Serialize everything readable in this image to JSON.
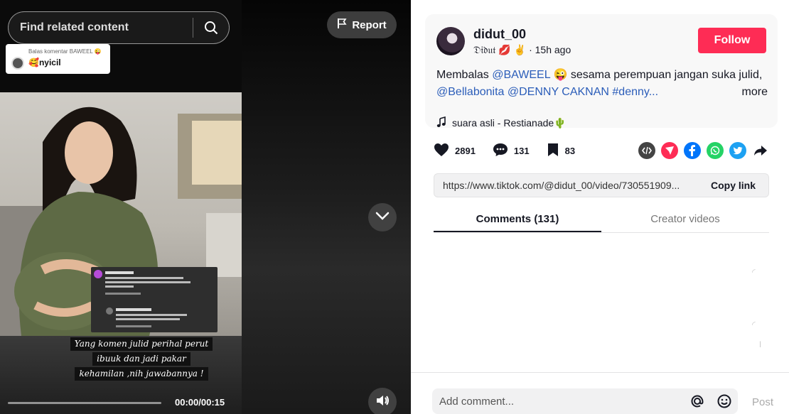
{
  "video": {
    "search_placeholder": "Find related content",
    "report_label": "Report",
    "reply_bubble": {
      "title": "Balas komentar BAWEEL 😜",
      "text": "🥰nyicil"
    },
    "caption_lines": [
      "Yang komen julid perihal perut",
      "ibuuk dan jadi pakar",
      "kehamilan ,nih jawabannya !"
    ],
    "time": "00:00/00:15",
    "progress": 0.0
  },
  "author": {
    "username": "didut_00",
    "nickname": "𝔇𝔦𝔡𝔲𝔱 💋 ✌",
    "posted": "15h ago",
    "follow_label": "Follow"
  },
  "description": {
    "prefix": "Membalas ",
    "mention1": "@BAWEEL",
    "middle": " 😜 sesama perempuan jangan suka julid,",
    "line2": "@Bellabonita @DENNY CAKNAN #denny...",
    "more_label": "more"
  },
  "music": {
    "label": "suara asli - Restianade🌵"
  },
  "stats": {
    "likes": "2891",
    "comments": "131",
    "saves": "83"
  },
  "share": {
    "url": "https://www.tiktok.com/@didut_00/video/730551909...",
    "copy_label": "Copy link",
    "icons": [
      "embed-icon",
      "send-icon",
      "facebook-icon",
      "whatsapp-icon",
      "twitter-icon",
      "share-arrow-icon"
    ],
    "colors": {
      "send": "#fe2c55",
      "facebook": "#0075fa",
      "whatsapp": "#25d366",
      "twitter": "#1da1f2",
      "embed": "#444"
    }
  },
  "tabs": [
    {
      "label": "Comments (131)"
    },
    {
      "label": "Creator videos"
    }
  ],
  "comment_box": {
    "placeholder": "Add comment...",
    "post_label": "Post"
  }
}
